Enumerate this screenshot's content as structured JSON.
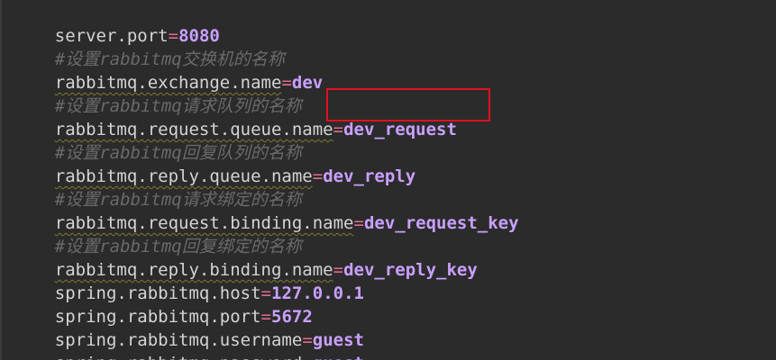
{
  "editor": {
    "lines": [
      {
        "type": "prop",
        "key": "server.port",
        "eq": "=",
        "value": "8080",
        "underline": false
      },
      {
        "type": "comment",
        "text": "#设置rabbitmq交换机的名称"
      },
      {
        "type": "prop",
        "key": "rabbitmq.exchange.name",
        "eq": "=",
        "value": "dev",
        "underline": true
      },
      {
        "type": "comment",
        "text": "#设置rabbitmq请求队列的名称"
      },
      {
        "type": "prop",
        "key": "rabbitmq.request.queue.name",
        "eq": "=",
        "value": "dev_request",
        "underline": true
      },
      {
        "type": "comment",
        "text": "#设置rabbitmq回复队列的名称"
      },
      {
        "type": "prop",
        "key": "rabbitmq.reply.queue.name",
        "eq": "=",
        "value": "dev_reply",
        "underline": true
      },
      {
        "type": "comment",
        "text": "#设置rabbitmq请求绑定的名称"
      },
      {
        "type": "prop",
        "key": "rabbitmq.request.binding.name",
        "eq": "=",
        "value": "dev_request_key",
        "underline": true
      },
      {
        "type": "comment",
        "text": "#设置rabbitmq回复绑定的名称"
      },
      {
        "type": "prop",
        "key": "rabbitmq.reply.binding.name",
        "eq": "=",
        "value": "dev_reply_key",
        "underline": true
      },
      {
        "type": "prop",
        "key": "spring.rabbitmq.host",
        "eq": "=",
        "value": "127.0.0.1",
        "underline": false
      },
      {
        "type": "prop",
        "key": "spring.rabbitmq.port",
        "eq": "=",
        "value": "5672",
        "underline": false
      },
      {
        "type": "prop",
        "key": "spring.rabbitmq.username",
        "eq": "=",
        "value": "guest",
        "underline": false
      },
      {
        "type": "prop",
        "key": "spring.rabbitmq.password",
        "eq": "=",
        "value": "guest",
        "underline": false
      }
    ]
  },
  "colors": {
    "background": "#2b2b2b",
    "key": "#d4d4d4",
    "equals": "#e06c8f",
    "value": "#c9a0ff",
    "comment": "#6a6a6a",
    "highlight_border": "#e3101d"
  }
}
